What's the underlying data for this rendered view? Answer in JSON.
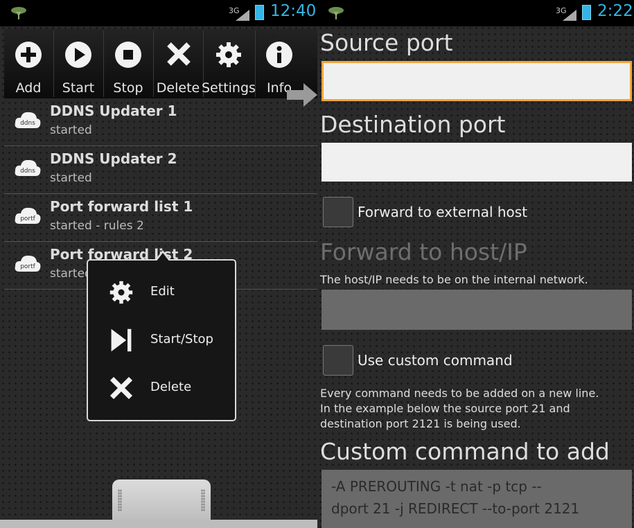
{
  "left": {
    "status": {
      "network": "3G",
      "time": "12:40"
    },
    "toolbar": [
      {
        "label": "Add",
        "icon": "plus-icon"
      },
      {
        "label": "Start",
        "icon": "play-icon"
      },
      {
        "label": "Stop",
        "icon": "stop-icon"
      },
      {
        "label": "Delete",
        "icon": "x-icon"
      },
      {
        "label": "Settings",
        "icon": "gear-icon"
      },
      {
        "label": "Info",
        "icon": "info-icon"
      }
    ],
    "items": [
      {
        "title": "DDNS Updater 1",
        "status": "started",
        "icon_text": "ddns"
      },
      {
        "title": "DDNS Updater 2",
        "status": "started",
        "icon_text": "ddns"
      },
      {
        "title": "Port forward list 1",
        "status": "started - rules 2",
        "icon_text": "portf"
      },
      {
        "title": "Port forward list 2",
        "status": "started",
        "icon_text": "portf"
      }
    ],
    "menu": [
      {
        "label": "Edit",
        "icon": "gear-icon"
      },
      {
        "label": "Start/Stop",
        "icon": "play-pause-icon"
      },
      {
        "label": "Delete",
        "icon": "x-icon"
      }
    ]
  },
  "right": {
    "status": {
      "network": "3G",
      "time": "2:22"
    },
    "source_port_label": "Source port",
    "source_port_value": "",
    "dest_port_label": "Destination port",
    "dest_port_value": "",
    "forward_external_label": "Forward to external host",
    "forward_external_checked": false,
    "forward_host_label": "Forward to host/IP",
    "forward_host_help": "The host/IP needs to be on the internal network.",
    "custom_cmd_checkbox_label": "Use custom command",
    "custom_cmd_help": [
      "Every command needs to be added on a new line.",
      "In the example below the source port 21 and",
      "destination port 2121 is being used."
    ],
    "custom_cmd_label": "Custom command to add",
    "custom_cmd_placeholder": [
      "-A PREROUTING -t nat -p tcp --",
      "dport 21 -j REDIRECT --to-port 2121"
    ]
  },
  "colors": {
    "accent": "#33b5e5",
    "focus": "#f3a63b"
  }
}
